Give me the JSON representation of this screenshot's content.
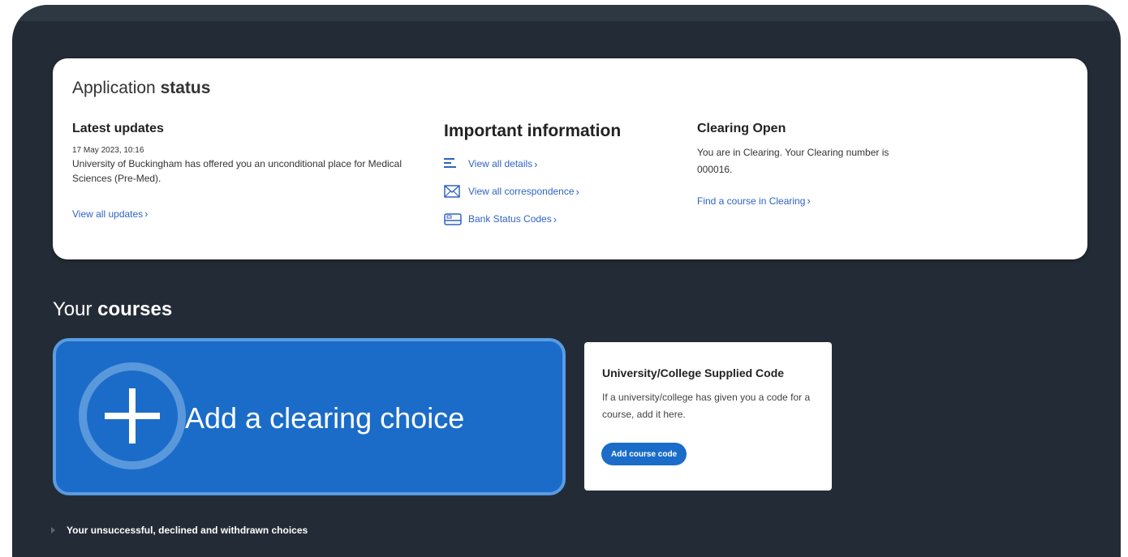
{
  "status_card": {
    "title_thin": "Application ",
    "title_bold": "status",
    "latest": {
      "title": "Latest updates",
      "date": "17 May 2023, 10:16",
      "text": "University of Buckingham has offered you an unconditional place for Medical Sciences (Pre-Med).",
      "link": "View all updates",
      "chevron": "›"
    },
    "important": {
      "title": "Important information",
      "links": [
        {
          "label": "View all details",
          "icon": "list-icon"
        },
        {
          "label": "View all correspondence",
          "icon": "envelope-icon"
        },
        {
          "label": "Bank Status Codes",
          "icon": "card-icon"
        }
      ]
    },
    "clearing": {
      "title": "Clearing Open",
      "text": "You are in Clearing. Your Clearing number is 000016.",
      "link": "Find a course in Clearing"
    }
  },
  "courses": {
    "title_thin": "Your ",
    "title_bold": "courses",
    "add_choice_label": "Add a clearing choice",
    "code_card": {
      "title": "University/College Supplied Code",
      "description": "If a university/college has given you a code for a course, add it here.",
      "button": "Add course code"
    },
    "unsuccessful_label": "Your unsuccessful, declined and withdrawn choices"
  },
  "colors": {
    "background": "#232c36",
    "accent_blue": "#1b6cc9",
    "link_blue": "#3063c4"
  }
}
